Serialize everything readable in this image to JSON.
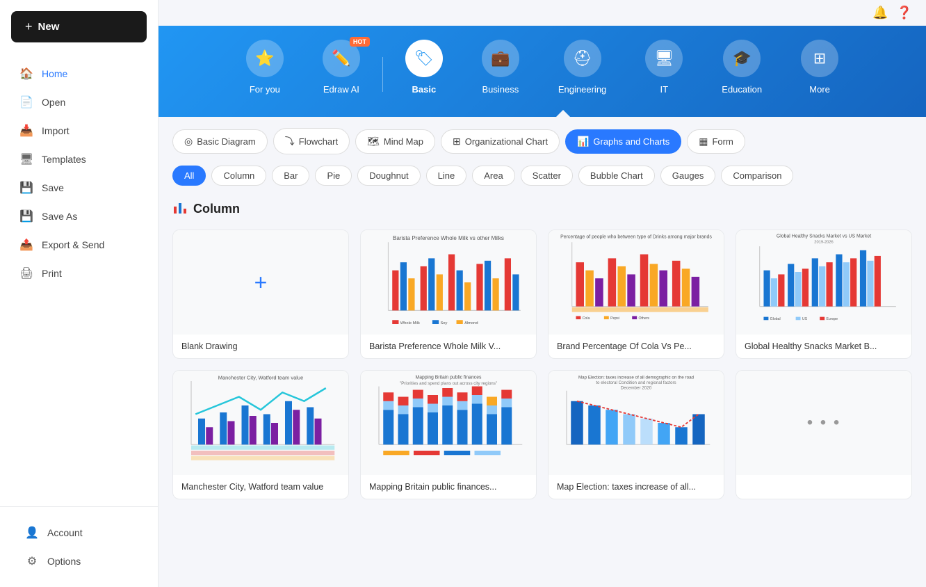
{
  "sidebar": {
    "new_label": "New",
    "items": [
      {
        "id": "home",
        "label": "Home",
        "icon": "🏠",
        "active": true
      },
      {
        "id": "open",
        "label": "Open",
        "icon": "📄"
      },
      {
        "id": "import",
        "label": "Import",
        "icon": "📥"
      },
      {
        "id": "templates",
        "label": "Templates",
        "icon": "🖥"
      },
      {
        "id": "save",
        "label": "Save",
        "icon": "💾"
      },
      {
        "id": "save-as",
        "label": "Save As",
        "icon": "💾"
      },
      {
        "id": "export",
        "label": "Export & Send",
        "icon": "📤"
      },
      {
        "id": "print",
        "label": "Print",
        "icon": "🖨"
      }
    ],
    "bottom_items": [
      {
        "id": "account",
        "label": "Account",
        "icon": "👤"
      },
      {
        "id": "options",
        "label": "Options",
        "icon": "⚙"
      }
    ]
  },
  "topbar": {
    "bell_icon": "🔔",
    "help_icon": "❓"
  },
  "hero": {
    "nav_items": [
      {
        "id": "for-you",
        "label": "For you",
        "icon": "⭐",
        "active": false
      },
      {
        "id": "edraw-ai",
        "label": "Edraw AI",
        "icon": "✏️",
        "active": false,
        "hot": true
      },
      {
        "id": "basic",
        "label": "Basic",
        "icon": "🏷",
        "active": true
      },
      {
        "id": "business",
        "label": "Business",
        "icon": "💼",
        "active": false
      },
      {
        "id": "engineering",
        "label": "Engineering",
        "icon": "⛑",
        "active": false
      },
      {
        "id": "it",
        "label": "IT",
        "icon": "🖥",
        "active": false
      },
      {
        "id": "education",
        "label": "Education",
        "icon": "🎓",
        "active": false
      },
      {
        "id": "more",
        "label": "More",
        "icon": "⊞",
        "active": false
      }
    ],
    "hot_label": "HOT"
  },
  "filter_tabs": [
    {
      "id": "basic-diagram",
      "label": "Basic Diagram",
      "icon": "◎",
      "active": false
    },
    {
      "id": "flowchart",
      "label": "Flowchart",
      "icon": "⤵",
      "active": false
    },
    {
      "id": "mind-map",
      "label": "Mind Map",
      "icon": "🗺",
      "active": false
    },
    {
      "id": "org-chart",
      "label": "Organizational Chart",
      "icon": "⊞",
      "active": false
    },
    {
      "id": "graphs-charts",
      "label": "Graphs and Charts",
      "icon": "📊",
      "active": true
    },
    {
      "id": "form",
      "label": "Form",
      "icon": "▦",
      "active": false
    }
  ],
  "sub_filters": [
    {
      "id": "all",
      "label": "All",
      "active": true
    },
    {
      "id": "column",
      "label": "Column",
      "active": false
    },
    {
      "id": "bar",
      "label": "Bar",
      "active": false
    },
    {
      "id": "pie",
      "label": "Pie",
      "active": false
    },
    {
      "id": "doughnut",
      "label": "Doughnut",
      "active": false
    },
    {
      "id": "line",
      "label": "Line",
      "active": false
    },
    {
      "id": "area",
      "label": "Area",
      "active": false
    },
    {
      "id": "scatter",
      "label": "Scatter",
      "active": false
    },
    {
      "id": "bubble-chart",
      "label": "Bubble Chart",
      "active": false
    },
    {
      "id": "gauges",
      "label": "Gauges",
      "active": false
    },
    {
      "id": "comparison",
      "label": "Comparison",
      "active": false
    }
  ],
  "section": {
    "title": "Column",
    "icon": "📊"
  },
  "cards_row1": [
    {
      "id": "blank",
      "title": "Blank Drawing",
      "type": "blank"
    },
    {
      "id": "barista",
      "title": "Barista Preference Whole Milk V...",
      "type": "chart1"
    },
    {
      "id": "cola",
      "title": "Brand Percentage Of Cola Vs Pe...",
      "type": "chart2"
    },
    {
      "id": "snacks",
      "title": "Global Healthy Snacks Market B...",
      "type": "chart3"
    }
  ],
  "cards_row2": [
    {
      "id": "manchester",
      "title": "Manchester City, Watford team value",
      "type": "chart4"
    },
    {
      "id": "mapping",
      "title": "Mapping Britain public finances...",
      "type": "chart5"
    },
    {
      "id": "election",
      "title": "Map Election: taxes increase of all...",
      "type": "chart6"
    },
    {
      "id": "more",
      "title": "...",
      "type": "more"
    }
  ]
}
